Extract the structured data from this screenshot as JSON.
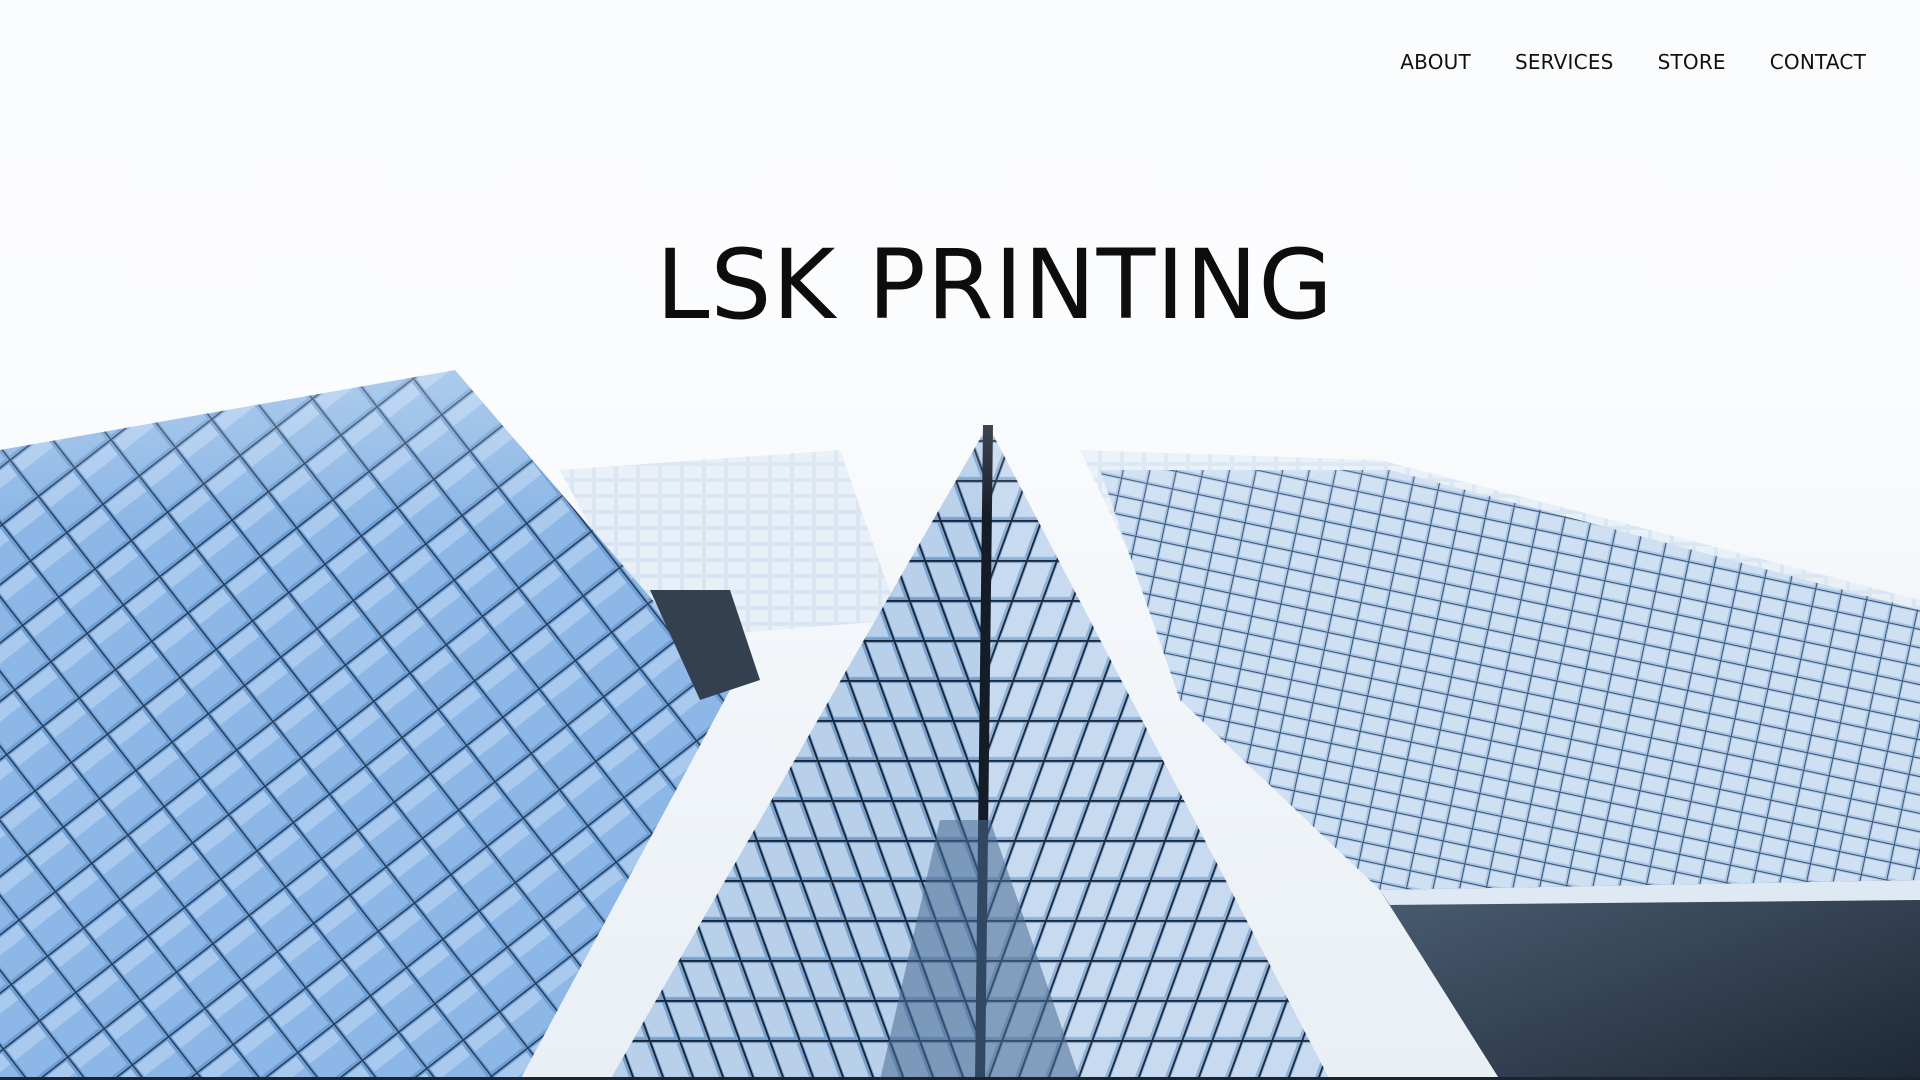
{
  "nav": {
    "items": [
      {
        "label": "ABOUT"
      },
      {
        "label": "SERVICES"
      },
      {
        "label": "STORE"
      },
      {
        "label": "CONTACT"
      }
    ]
  },
  "hero": {
    "title": "LSK PRINTING",
    "image": "glass-skyscrapers-photo"
  },
  "colors": {
    "text": "#111111",
    "glass_blue": "#7fa6d3",
    "sky": "#fbfcfd"
  }
}
